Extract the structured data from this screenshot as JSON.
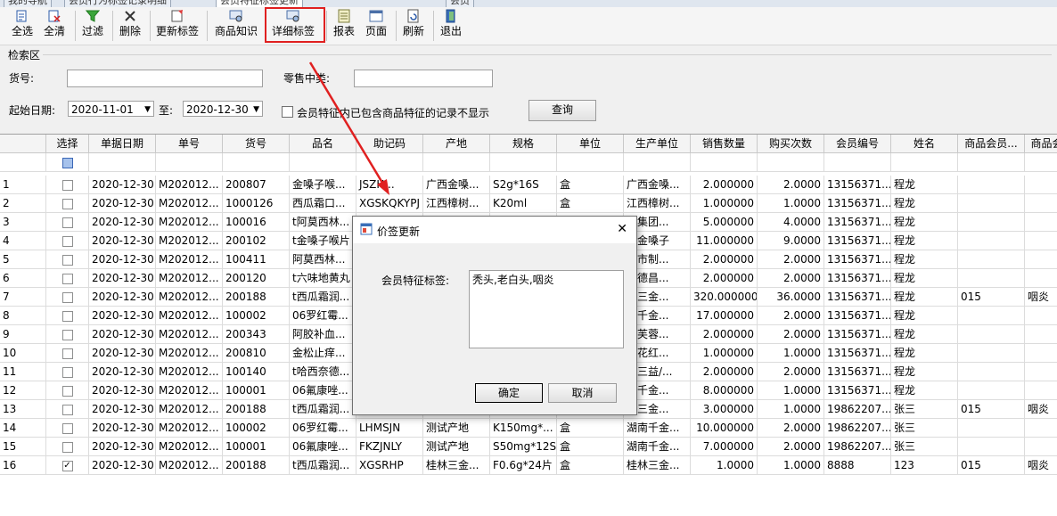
{
  "tabs": [
    "我的导航",
    "会员行为标签记录明细",
    "会员特征标签更新",
    "会员"
  ],
  "toolbar": [
    {
      "label": "全选",
      "icon": "select-all-icon"
    },
    {
      "label": "全清",
      "icon": "clear-all-icon"
    },
    {
      "label": "过滤",
      "icon": "filter-icon"
    },
    {
      "label": "删除",
      "icon": "delete-icon"
    },
    {
      "label": "更新标签",
      "icon": "update-tag-icon"
    },
    {
      "label": "商品知识",
      "icon": "product-knowledge-icon"
    },
    {
      "label": "详细标签",
      "icon": "detail-tag-icon"
    },
    {
      "label": "报表",
      "icon": "report-icon"
    },
    {
      "label": "页面",
      "icon": "page-icon"
    },
    {
      "label": "刷新",
      "icon": "refresh-icon"
    },
    {
      "label": "退出",
      "icon": "exit-icon"
    }
  ],
  "search": {
    "group_title": "检索区",
    "item_no_label": "货号:",
    "item_no_value": "",
    "retail_class_label": "零售中类:",
    "retail_class_value": "",
    "start_date_label": "起始日期:",
    "start_date": "2020-11-01",
    "to_label": "至:",
    "end_date": "2020-12-30",
    "checkbox_label": "会员特征内已包含商品特征的记录不显示",
    "query_button": "查询"
  },
  "grid": {
    "columns": [
      "",
      "选择",
      "单据日期",
      "单号",
      "货号",
      "品名",
      "助记码",
      "产地",
      "规格",
      "单位",
      "生产单位",
      "销售数量",
      "购买次数",
      "会员编号",
      "姓名",
      "商品会员...",
      "商品会"
    ],
    "rows": [
      [
        "1",
        "",
        "2020-12-30",
        "M202012...",
        "200807",
        "金嗓子喉...",
        "JSZH...",
        "广西金嗓...",
        "S2g*16S",
        "盒",
        "广西金嗓...",
        "2.000000",
        "2.0000",
        "13156371...",
        "程龙",
        "",
        ""
      ],
      [
        "2",
        "",
        "2020-12-30",
        "M202012...",
        "1000126",
        "西瓜霜口...",
        "XGSKQKYPJ",
        "江西樟树...",
        "K20ml",
        "盒",
        "江西樟树...",
        "1.000000",
        "1.0000",
        "13156371...",
        "程龙",
        "",
        ""
      ],
      [
        "3",
        "",
        "2020-12-30",
        "M202012...",
        "100016",
        "t阿莫西林...",
        "",
        "",
        "",
        "",
        "药集团...",
        "5.000000",
        "4.0000",
        "13156371...",
        "程龙",
        "",
        ""
      ],
      [
        "4",
        "",
        "2020-12-30",
        "M202012...",
        "200102",
        "t金嗓子喉片",
        "",
        "",
        "",
        "",
        "西金嗓子",
        "11.000000",
        "9.0000",
        "13156371...",
        "程龙",
        "",
        ""
      ],
      [
        "5",
        "",
        "2020-12-30",
        "M202012...",
        "100411",
        "阿莫西林...",
        "",
        "",
        "",
        "",
        "口市制...",
        "2.000000",
        "2.0000",
        "13156371...",
        "程龙",
        "",
        ""
      ],
      [
        "6",
        "",
        "2020-12-30",
        "M202012...",
        "200120",
        "t六味地黄丸",
        "",
        "",
        "",
        "",
        "阳德昌...",
        "2.000000",
        "2.0000",
        "13156371...",
        "程龙",
        "",
        ""
      ],
      [
        "7",
        "",
        "2020-12-30",
        "M202012...",
        "200188",
        "t西瓜霜润...",
        "",
        "",
        "",
        "",
        "林三金...",
        "320.000000",
        "36.0000",
        "13156371...",
        "程龙",
        "015",
        "咽炎"
      ],
      [
        "8",
        "",
        "2020-12-30",
        "M202012...",
        "100002",
        "06罗红霉...",
        "",
        "",
        "",
        "",
        "南千金...",
        "17.000000",
        "2.0000",
        "13156371...",
        "程龙",
        "",
        ""
      ],
      [
        "9",
        "",
        "2020-12-30",
        "M202012...",
        "200343",
        "阿胶补血...",
        "",
        "",
        "",
        "",
        "西芙蓉...",
        "2.000000",
        "2.0000",
        "13156371...",
        "程龙",
        "",
        ""
      ],
      [
        "10",
        "",
        "2020-12-30",
        "M202012...",
        "200810",
        "金松止痒...",
        "",
        "",
        "",
        "",
        "西花红...",
        "1.000000",
        "1.0000",
        "13156371...",
        "程龙",
        "",
        ""
      ],
      [
        "11",
        "",
        "2020-12-30",
        "M202012...",
        "100140",
        "t哈西奈德...",
        "",
        "",
        "",
        "",
        "湖三益/...",
        "2.000000",
        "2.0000",
        "13156371...",
        "程龙",
        "",
        ""
      ],
      [
        "12",
        "",
        "2020-12-30",
        "M202012...",
        "100001",
        "06氟康唑...",
        "",
        "",
        "",
        "",
        "南千金...",
        "8.000000",
        "1.0000",
        "13156371...",
        "程龙",
        "",
        ""
      ],
      [
        "13",
        "",
        "2020-12-30",
        "M202012...",
        "200188",
        "t西瓜霜润...",
        "",
        "",
        "",
        "",
        "林三金...",
        "3.000000",
        "1.0000",
        "19862207...",
        "张三",
        "015",
        "咽炎"
      ],
      [
        "14",
        "",
        "2020-12-30",
        "M202012...",
        "100002",
        "06罗红霉...",
        "LHMSJN",
        "测试产地",
        "K150mg*...",
        "盒",
        "湖南千金...",
        "10.000000",
        "2.0000",
        "19862207...",
        "张三",
        "",
        ""
      ],
      [
        "15",
        "",
        "2020-12-30",
        "M202012...",
        "100001",
        "06氟康唑...",
        "FKZJNLY",
        "测试产地",
        "S50mg*12S",
        "盒",
        "湖南千金...",
        "7.000000",
        "2.0000",
        "19862207...",
        "张三",
        "",
        ""
      ],
      [
        "16",
        "✓",
        "2020-12-30",
        "M202012...",
        "200188",
        "t西瓜霜润...",
        "XGSRHP",
        "桂林三金...",
        "F0.6g*24片",
        "盒",
        "桂林三金...",
        "1.0000",
        "1.0000",
        "8888",
        "123",
        "015",
        "咽炎"
      ]
    ]
  },
  "dialog": {
    "title": "价签更新",
    "field_label": "会员特征标签:",
    "field_value": "秃头,老白头,咽炎",
    "ok_button": "确定",
    "cancel_button": "取消",
    "close_glyph": "✕"
  },
  "colors": {
    "highlight": "#e02020",
    "arrow": "#e02020",
    "selected_row": "#f2f2f2"
  }
}
